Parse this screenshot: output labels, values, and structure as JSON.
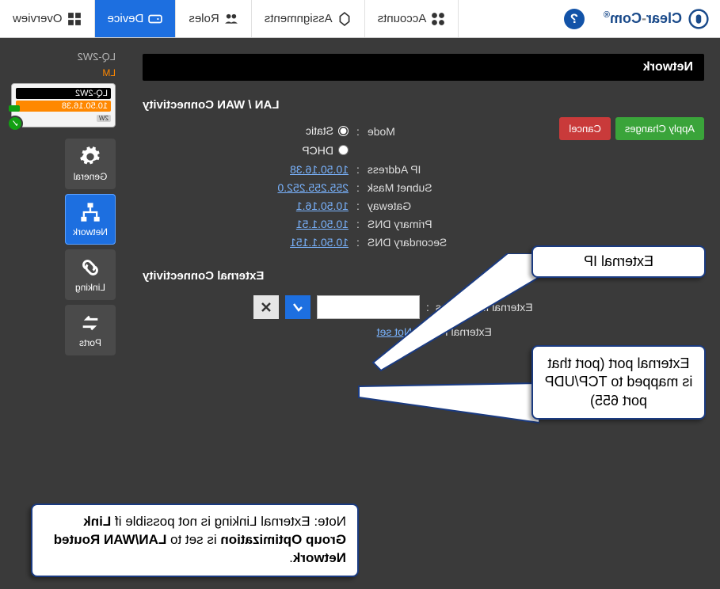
{
  "brand": {
    "name_part1": "Clear",
    "name_part2": "Com"
  },
  "help": "?",
  "nav": {
    "overview": "Overview",
    "device": "Device",
    "roles": "Roles",
    "assignments": "Assignments",
    "accounts": "Accounts"
  },
  "side": {
    "device_tag": "LQ-2W2",
    "lm": "LM",
    "card": {
      "name": "LQ-2W2",
      "ip": "10.50.16.38",
      "chip": "2W"
    },
    "tiles": {
      "general": "General",
      "network": "Network",
      "linking": "Linking",
      "ports": "Ports"
    }
  },
  "panel": {
    "title": "Network",
    "lan_title": "LAN / WAN Connectivity",
    "ext_title": "External Connectivity",
    "mode_label": "Mode",
    "mode_static": "Static",
    "mode_dhcp": "DHCP",
    "labels": {
      "ip": "IP Address",
      "subnet": "Subnet Mask",
      "gateway": "Gateway",
      "pri_dns": "Primary DNS",
      "sec_dns": "Secondary DNS",
      "ext_ip": "External IP Address",
      "ext_port": "External Port"
    },
    "values": {
      "ip": "10.50.16.38",
      "subnet": "255.255.252.0",
      "gateway": "10.50.16.1",
      "pri_dns": "10.50.1.51",
      "sec_dns": "10.50.1.151",
      "ext_ip": "",
      "ext_port": "Not set"
    },
    "buttons": {
      "apply": "Apply Changes",
      "cancel": "Cancel"
    }
  },
  "callouts": {
    "ext_ip": "External IP",
    "ext_port": "External port (port that is mapped to TCP/UDP port 655)",
    "note_prefix": "Note: External Linking is not possible if ",
    "note_bold1": "Link Group Optimization",
    "note_mid": " is set to ",
    "note_bold2": "LAN/WAN Routed Network",
    "note_suffix": "."
  }
}
